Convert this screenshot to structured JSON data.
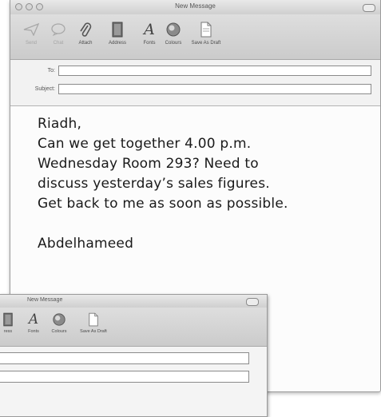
{
  "window": {
    "title": "New Message"
  },
  "toolbar": {
    "items": [
      {
        "label": "Send",
        "icon": "send-icon",
        "enabled": false
      },
      {
        "label": "Chat",
        "icon": "chat-icon",
        "enabled": false
      },
      {
        "label": "Attach",
        "icon": "paperclip-icon",
        "enabled": true
      },
      {
        "label": "Address",
        "icon": "address-book-icon",
        "enabled": true
      },
      {
        "label": "Fonts",
        "icon": "fonts-icon",
        "enabled": true
      },
      {
        "label": "Colours",
        "icon": "colours-icon",
        "enabled": true
      },
      {
        "label": "Save As Draft",
        "icon": "draft-icon",
        "enabled": true
      }
    ]
  },
  "headers": {
    "to_label": "To:",
    "to_value": "",
    "subject_label": "Subject:",
    "subject_value": ""
  },
  "body": {
    "lines": [
      "Riadh,",
      "Can we get together 4.00 p.m.",
      "Wednesday Room 293? Need to",
      "discuss  yesterday’s  sales  figures.",
      "Get back to me as soon as possible.",
      "",
      "Abdelhameed"
    ]
  },
  "second_window": {
    "title": "New Message",
    "toolbar_items": [
      {
        "label": "ress",
        "icon": "address-book-icon"
      },
      {
        "label": "Fonts",
        "icon": "fonts-icon"
      },
      {
        "label": "Colours",
        "icon": "colours-icon"
      },
      {
        "label": "Save As Draft",
        "icon": "draft-icon"
      }
    ]
  }
}
